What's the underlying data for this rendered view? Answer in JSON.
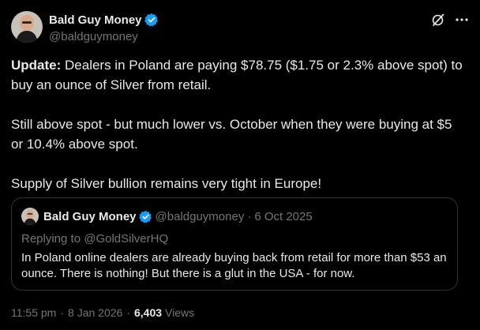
{
  "author": {
    "display_name": "Bald Guy Money",
    "handle": "@baldguymoney"
  },
  "icons": {
    "verified": "verified-badge-icon",
    "grok": "grok-icon",
    "more": "more-options-icon"
  },
  "colors": {
    "verified_blue": "#1d9bf0",
    "secondary_text": "#71767b",
    "primary_text": "#e7e9ea",
    "border": "#2f3336",
    "background": "#000000"
  },
  "post": {
    "para1_label": "Update:",
    "para1_text": " Dealers in Poland are paying $78.75 ($1.75 or 2.3% above spot) to buy an ounce of Silver from retail.",
    "para2": "Still above spot - but much lower vs. October when they were buying at $5 or 10.4% above spot.",
    "para3": "Supply of Silver bullion remains very tight in Europe!"
  },
  "quoted": {
    "display_name": "Bald Guy Money",
    "handle": "@baldguymoney",
    "separator": "·",
    "date": "6 Oct 2025",
    "replying_prefix": "Replying to ",
    "replying_to": "@GoldSilverHQ",
    "text": "In Poland online dealers are already buying back from retail for more than $53 an ounce. There is nothing! But there is a glut in the USA - for now."
  },
  "meta": {
    "time": "11:55 pm",
    "separator": "·",
    "date": "8 Jan 2026",
    "views_count": "6,403",
    "views_label": "Views"
  }
}
